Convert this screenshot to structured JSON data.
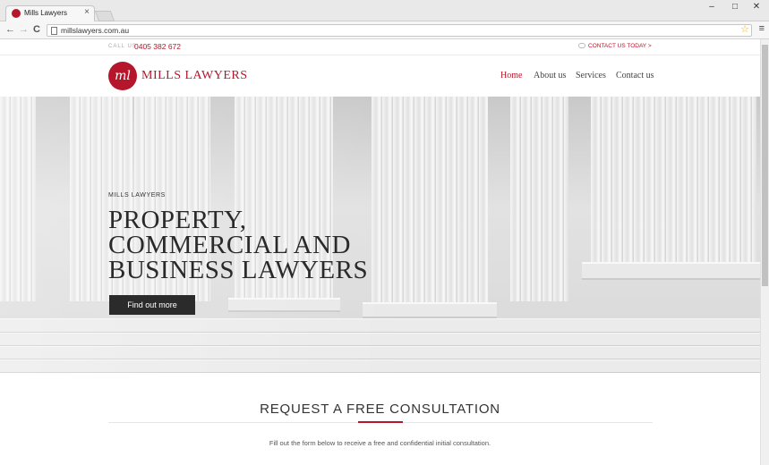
{
  "browser": {
    "tab_title": "Mills Lawyers",
    "tab_close": "×",
    "url": "millslawyers.com.au",
    "back": "←",
    "forward": "→",
    "reload": "C",
    "star": "☆",
    "menu": "≡",
    "minimize": "–",
    "maximize": "□",
    "close": "✕"
  },
  "topbar": {
    "call_label": "CALL US:",
    "phone": "0405 382 672",
    "contact_link": "CONTACT US TODAY >"
  },
  "header": {
    "logo_mark": "ml",
    "logo_text": "MILLS LAWYERS",
    "nav": [
      "Home",
      "About us",
      "Services",
      "Contact us"
    ]
  },
  "hero": {
    "kicker": "MILLS LAWYERS",
    "title": "PROPERTY, COMMERCIAL AND BUSINESS LAWYERS",
    "button": "Find out more"
  },
  "consult": {
    "title": "REQUEST A FREE CONSULTATION",
    "subtitle": "Fill out the form below to receive a free and confidential initial consultation."
  },
  "colors": {
    "brand": "#b5162b",
    "dark": "#2b2b2b"
  }
}
